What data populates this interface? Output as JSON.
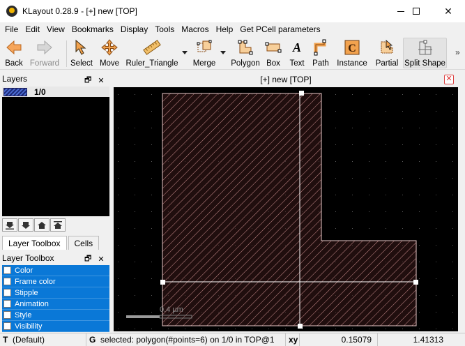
{
  "window": {
    "title": "KLayout 0.28.9 - [+] new [TOP]"
  },
  "menu": [
    "File",
    "Edit",
    "View",
    "Bookmarks",
    "Display",
    "Tools",
    "Macros",
    "Help",
    "Get PCell parameters"
  ],
  "toolbar": {
    "back": "Back",
    "forward": "Forward",
    "select": "Select",
    "move": "Move",
    "ruler": "Ruler_Triangle",
    "merge": "Merge",
    "polygon": "Polygon",
    "box": "Box",
    "text": "Text",
    "path": "Path",
    "instance": "Instance",
    "partial": "Partial",
    "split_shape": "Split Shape",
    "more": "»"
  },
  "layers_panel": {
    "title": "Layers",
    "float_icon": "🗗",
    "close_icon": "✕",
    "layers": [
      {
        "name": "1/0",
        "color": "#1c2a78"
      }
    ]
  },
  "tabs": [
    "Layer Toolbox",
    "Cells"
  ],
  "layer_toolbox": {
    "title": "Layer Toolbox",
    "items": [
      "Color",
      "Frame color",
      "Stipple",
      "Animation",
      "Style",
      "Visibility"
    ]
  },
  "view": {
    "title": "[+] new [TOP]",
    "scale_label": "0.4 µm",
    "fill_color": "#d8a0a0"
  },
  "statusbar": {
    "mode_key": "T",
    "mode_value": "(Default)",
    "g_key": "G",
    "message": "selected: polygon(#points=6) on 1/0 in TOP@1",
    "coord_key": "xy",
    "x": "0.15079",
    "y": "1.41313"
  }
}
